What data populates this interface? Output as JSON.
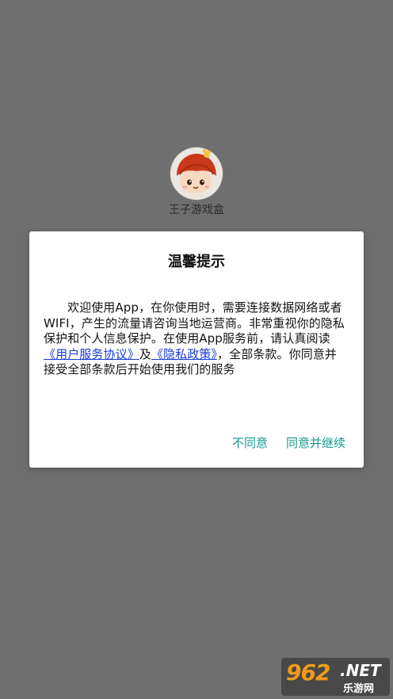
{
  "app": {
    "name": "王子游戏盒",
    "logo_icon": "mushroom-character-icon"
  },
  "dialog": {
    "title": "温馨提示",
    "body_part1": "欢迎使用App，在你使用时，需要连接数据网络或者WIFI，产生的流量请咨询当地运营商。非常重视你的隐私保护和个人信息保护。在使用App服务前，请认真阅读",
    "link_user_agreement": "《用户服务协议》",
    "body_and": "及",
    "link_privacy_policy": "《隐私政策》",
    "body_part2": "，全部条款。你同意并接受全部条款后开始使用我们的服务",
    "disagree_label": "不同意",
    "agree_label": "同意并继续"
  },
  "watermark": {
    "number": "962",
    "suffix": ".NET",
    "site_name": "乐游网"
  },
  "colors": {
    "overlay": "#6f6f6f",
    "dialog_bg": "#ffffff",
    "button_text": "#169b8e",
    "link": "#1a3bd6"
  }
}
